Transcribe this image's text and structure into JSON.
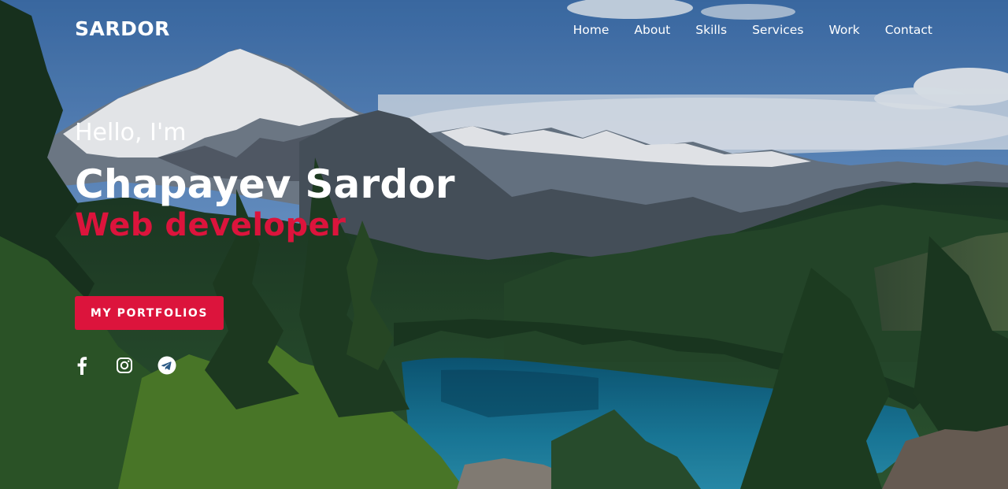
{
  "brand": {
    "logo_text": "SARDOR"
  },
  "nav": {
    "items": [
      {
        "label": "Home"
      },
      {
        "label": "About"
      },
      {
        "label": "Skills"
      },
      {
        "label": "Services"
      },
      {
        "label": "Work"
      },
      {
        "label": "Contact"
      }
    ]
  },
  "hero": {
    "greeting": "Hello, I'm",
    "name": "Chapayev Sardor",
    "role": "Web developer",
    "cta_label": "MY PORTFOLIOS"
  },
  "socials": [
    {
      "icon": "facebook-icon"
    },
    {
      "icon": "instagram-icon"
    },
    {
      "icon": "telegram-icon"
    }
  ],
  "colors": {
    "accent": "#dc143c",
    "text": "#ffffff"
  }
}
